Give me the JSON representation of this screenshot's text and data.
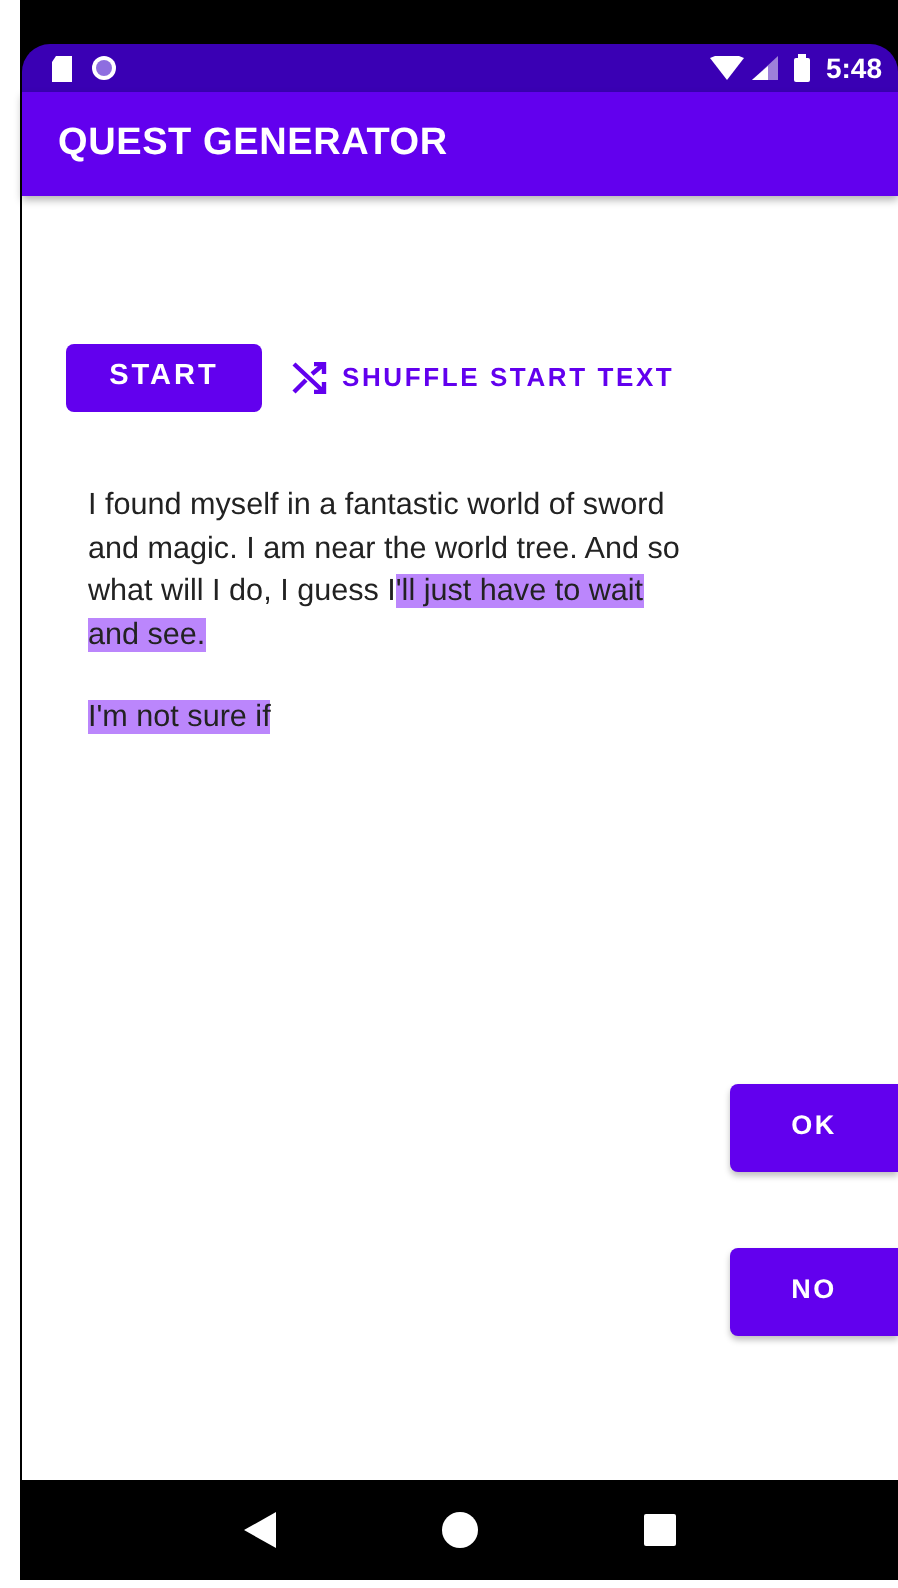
{
  "status_bar": {
    "time": "5:48"
  },
  "app_bar": {
    "title": "QUEST GENERATOR"
  },
  "actions": [
    {
      "kind": "filled",
      "label": "START"
    },
    {
      "kind": "text",
      "label": "SHUFFLE START TEXT"
    }
  ],
  "story": [
    {
      "segments": [
        {
          "text": "I found myself in a fantastic world of sword and magic. I am near the world tree. And so what will I do, I guess I",
          "highlighted": false
        },
        {
          "text": "'ll just have to wait and see.",
          "highlighted": true
        }
      ]
    },
    {
      "segments": [
        {
          "text": "I'm not sure if",
          "highlighted": true
        }
      ]
    }
  ],
  "choices": [
    {
      "label": "OK"
    },
    {
      "label": "NO"
    }
  ]
}
